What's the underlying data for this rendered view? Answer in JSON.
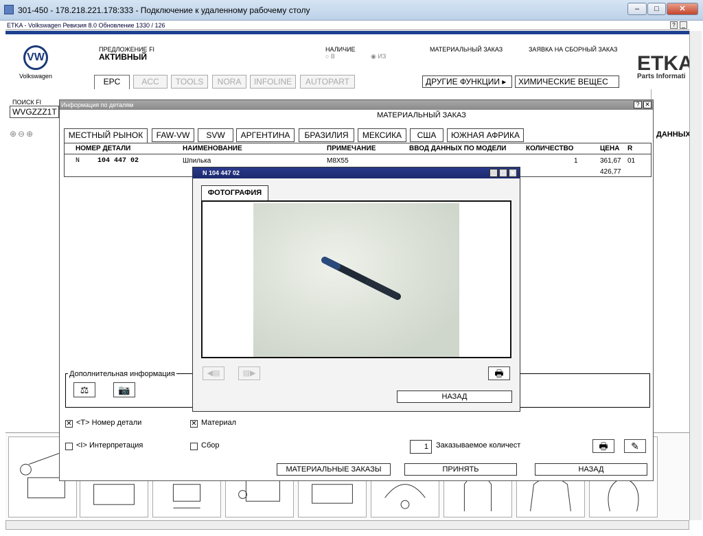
{
  "rdp": {
    "title": "301-450 - 178.218.221.178:333 - Подключение к удаленному рабочему столу",
    "min": "–",
    "max": "□",
    "close": "✕"
  },
  "etka": {
    "title": "ETKA - Volkswagen Ревизия 8.0 Обновление 1330 / 126",
    "help": "?",
    "brand_logo": "Volkswagen",
    "brand_name": "ETKA",
    "brand_sub": "Parts Informati",
    "offer_label": "ПРЕДЛОЖЕНИЕ FI",
    "offer_value": "АКТИВНЫЙ",
    "availability_label": "НАЛИЧИЕ",
    "availability_opt1": "○ В",
    "availability_opt2": "◉ ИЗ",
    "material_order": "МАТЕРИАЛЬНЫЙ ЗАКАЗ",
    "assembly_order": "ЗАЯВКА НА СБОРНЫЙ ЗАКАЗ",
    "tabs": [
      "EPC",
      "ACC",
      "TOOLS",
      "NORA",
      "INFOLINE",
      "AUTOPART"
    ],
    "other_functions": "ДРУГИЕ ФУНКЦИИ ▸",
    "chemicals": "ХИМИЧЕСКИЕ ВЕЩЕС",
    "search_label": "ПОИСК FI",
    "search_value": "WVGZZZ1T",
    "right_header": "ДАННЫХ П"
  },
  "dialog": {
    "title": "Информация по деталям",
    "help": "?",
    "close": "✕",
    "heading": "МАТЕРИАЛЬНЫЙ ЗАКАЗ",
    "market_tabs": [
      "МЕСТНЫЙ РЫНОК",
      "FAW-VW",
      "SVW",
      "АРГЕНТИНА",
      "БРАЗИЛИЯ",
      "МЕКСИКА",
      "США",
      "ЮЖНАЯ АФРИКА"
    ],
    "columns": [
      "НОМЕР ДЕТАЛИ",
      "НАИМЕНОВАНИЕ",
      "ПРИМЕЧАНИЕ",
      "ВВОД ДАННЫХ ПО МОДЕЛИ",
      "КОЛИЧЕСТВО",
      "ЦЕНА",
      "R"
    ],
    "row": {
      "prefix": "N",
      "part_number": "104 447 02",
      "name": "Шпилька",
      "note": "M8X55",
      "qty": "1",
      "price": "361,67",
      "price2": "426,77",
      "r": "01"
    },
    "addinfo_label": "Дополнительная информация",
    "chk_part_number": "<T> Номер детали",
    "chk_material": "Материал",
    "chk_interpretation": "<I> Интерпретация",
    "chk_assembly": "Сбор",
    "qty_value": "1",
    "qty_label": "Заказываемое количест",
    "btn_material_orders": "МАТЕРИАЛЬНЫЕ ЗАКАЗЫ",
    "btn_accept": "ПРИНЯТЬ",
    "btn_back": "НАЗАД"
  },
  "photo": {
    "title": "N  104 447 02",
    "tab": "ФОТОГРАФИЯ",
    "btn_back": "НАЗАД",
    "min": "_",
    "max": "□",
    "close": "✕"
  }
}
